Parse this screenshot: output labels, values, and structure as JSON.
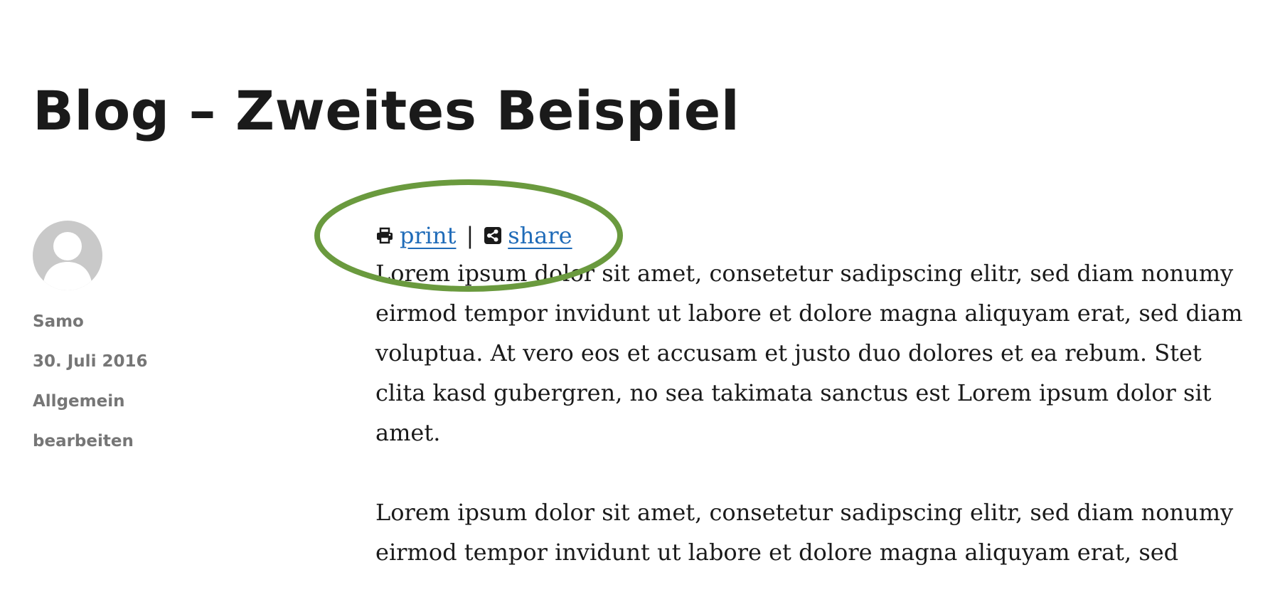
{
  "post": {
    "title": "Blog – Zweites Beispiel",
    "author": "Samo",
    "date": "30. Juli 2016",
    "category": "Allgemein",
    "edit_label": "bearbeiten"
  },
  "tools": {
    "print_icon": "printer-icon",
    "print_label": "print",
    "separator": "|",
    "share_icon": "share-icon",
    "share_label": "share"
  },
  "content": {
    "paragraphs": [
      "Lorem ipsum dolor sit amet, consetetur sadipscing elitr, sed diam nonumy eirmod tempor invidunt ut labore et dolore magna aliquyam erat, sed diam voluptua. At vero eos et accusam et justo duo dolores et ea rebum. Stet clita kasd gubergren, no sea takimata sanctus est Lorem ipsum dolor sit amet.",
      "Lorem ipsum dolor sit amet, consetetur sadipscing elitr, sed diam nonumy eirmod tempor invidunt ut labore et dolore magna aliquyam erat, sed"
    ]
  },
  "colors": {
    "link": "#1f6bb8",
    "meta": "#767676",
    "highlight": "#6a9a3e",
    "avatar": "#c9c9c9"
  }
}
